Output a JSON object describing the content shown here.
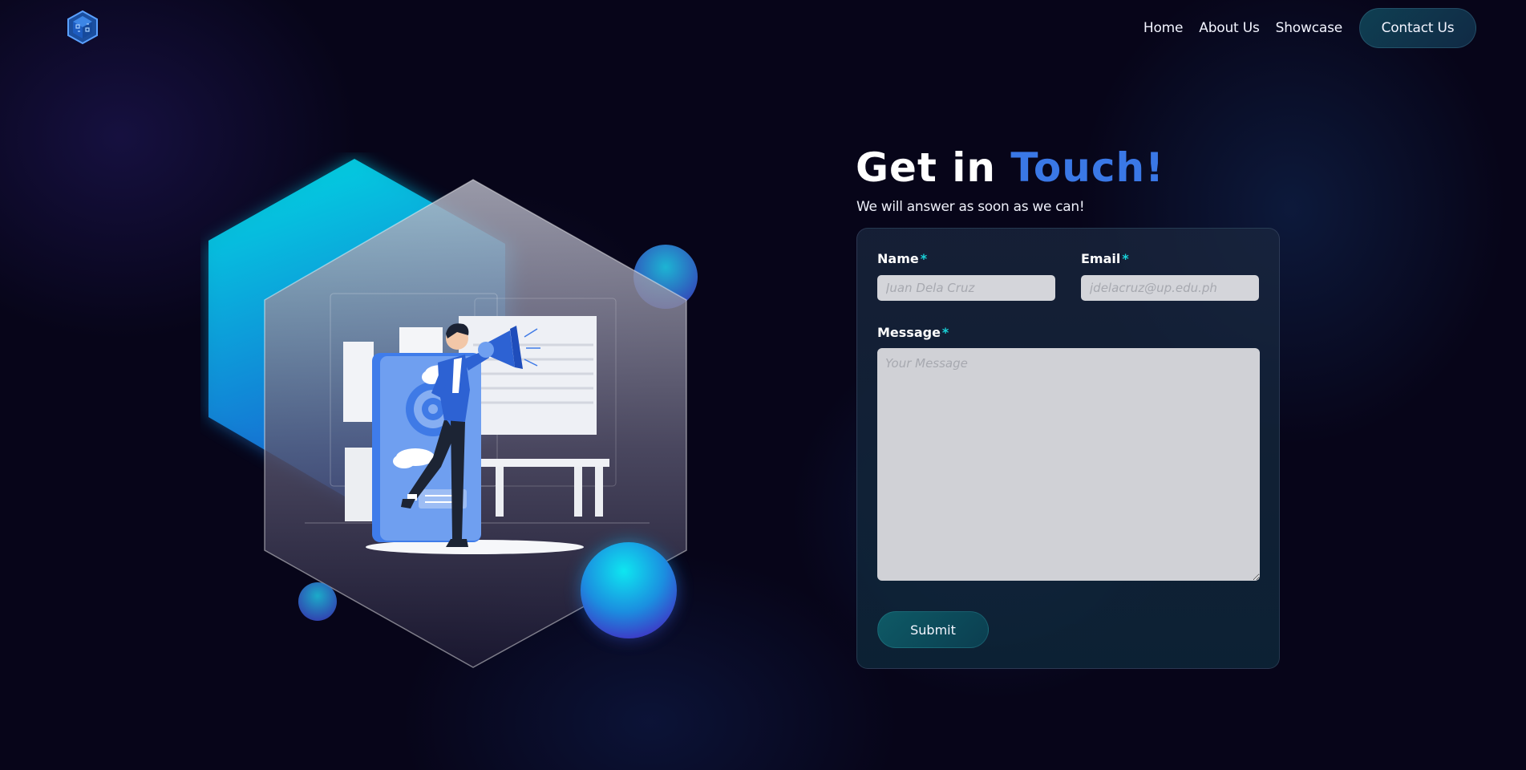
{
  "nav": {
    "logo_icon": "cube-logo-icon",
    "links": [
      "Home",
      "About Us",
      "Showcase"
    ],
    "contact_label": "Contact Us"
  },
  "hero": {
    "title_part1": "Get in",
    "title_accent": "Touch!",
    "subtitle": "We will answer as soon as we can!",
    "illustration": "man-with-megaphone-illustration"
  },
  "form": {
    "name_label": "Name",
    "name_placeholder": "Juan Dela Cruz",
    "email_label": "Email",
    "email_placeholder": "jdelacruz@up.edu.ph",
    "message_label": "Message",
    "message_placeholder": "Your Message",
    "required_mark": "*",
    "submit_label": "Submit"
  },
  "colors": {
    "background": "#070519",
    "accent": "#3a78e6",
    "required": "#19d2d8",
    "button": "#0e5a66"
  }
}
